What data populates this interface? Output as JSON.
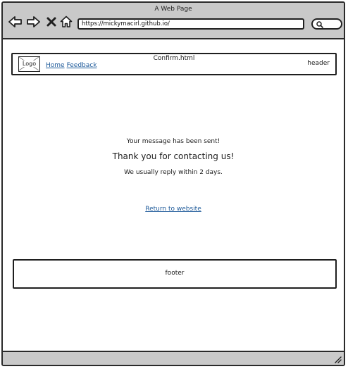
{
  "browser": {
    "window_title": "A Web Page",
    "url": "https://mickymacirl.github.io/",
    "icons": [
      "back-arrow-icon",
      "forward-arrow-icon",
      "close-x-icon",
      "home-icon",
      "search-icon",
      "resize-grip-icon"
    ]
  },
  "header": {
    "logo_label": "Logo",
    "nav": [
      {
        "label": "Home"
      },
      {
        "label": "Feedback"
      }
    ],
    "page_name": "Confirm.html",
    "section_label": "header"
  },
  "main": {
    "sent_message": "Your message has been sent!",
    "thanks_message": "Thank you for contacting us!",
    "reply_message": "We usually reply within 2 days.",
    "return_link": "Return to website"
  },
  "footer": {
    "label": "footer"
  },
  "colors": {
    "chrome": "#c9c9c9",
    "link": "#1e5a9a",
    "stroke": "#1f1f1f"
  }
}
